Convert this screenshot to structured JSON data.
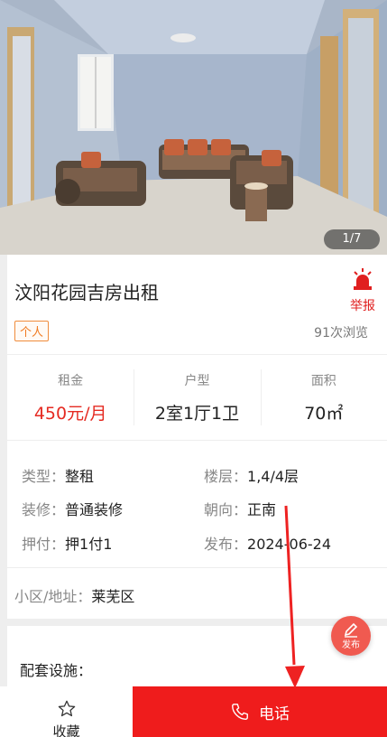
{
  "gallery": {
    "counter": "1/7"
  },
  "listing": {
    "title": "汶阳花园吉房出租",
    "report_label": "举报",
    "tag": "个人",
    "views": "91次浏览"
  },
  "stats": [
    {
      "label": "租金",
      "value": "450元/月"
    },
    {
      "label": "户型",
      "value": "2室1厅1卫"
    },
    {
      "label": "面积",
      "value": "70㎡"
    }
  ],
  "details": {
    "type_label": "类型：",
    "type_value": "整租",
    "floor_label": "楼层：",
    "floor_value": "1,4/4层",
    "decor_label": "装修：",
    "decor_value": "普通装修",
    "orient_label": "朝向：",
    "orient_value": "正南",
    "deposit_label": "押付：",
    "deposit_value": "押1付1",
    "publish_label": "发布：",
    "publish_value": "2024-06-24"
  },
  "address": {
    "label": "小区/地址：",
    "value": "莱芜区"
  },
  "facilities": {
    "label": "配套设施："
  },
  "publish_button": {
    "label": "发布"
  },
  "bottom_bar": {
    "favorite_label": "收藏",
    "call_label": "电话"
  },
  "colors": {
    "accent_red": "#ef1c1c",
    "price_red": "#e52a21",
    "tag_orange": "#f07a20",
    "publish_bg": "#f05a50"
  },
  "icons": [
    "alarm-icon",
    "pencil-icon",
    "star-icon",
    "phone-icon"
  ]
}
